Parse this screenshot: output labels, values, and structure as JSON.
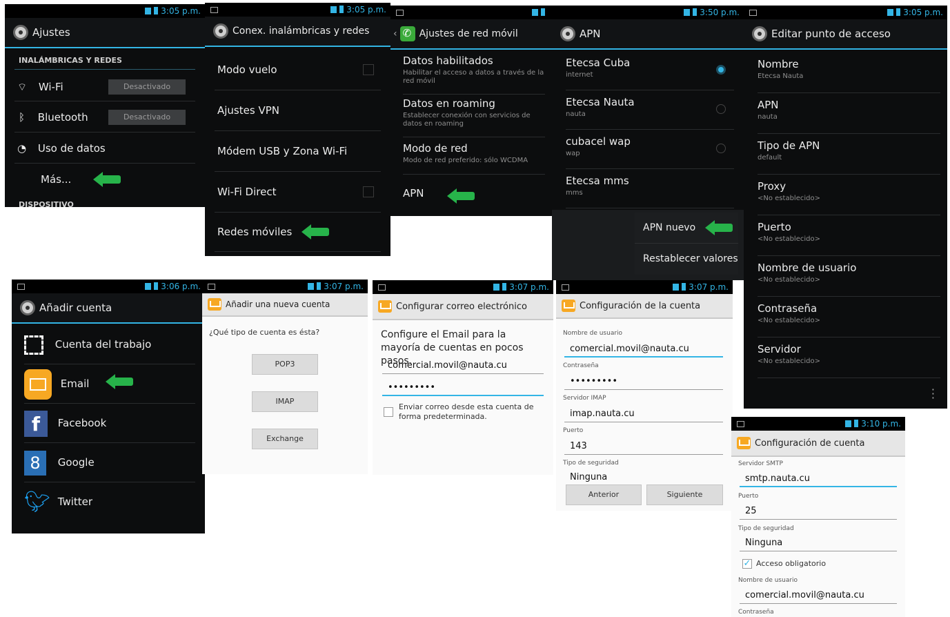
{
  "screens": {
    "ajustes": {
      "time": "3:05 p.m.",
      "title": "Ajustes",
      "section": "INALÁMBRICAS Y REDES",
      "wifi": {
        "label": "Wi-Fi",
        "state": "Desactivado"
      },
      "bluetooth": {
        "label": "Bluetooth",
        "state": "Desactivado"
      },
      "data_usage": "Uso de datos",
      "more": "Más...",
      "section2": "DISPOSITIVO"
    },
    "conex": {
      "time": "3:05 p.m.",
      "title": "Conex. inalámbricas y redes",
      "items": [
        "Modo vuelo",
        "Ajustes VPN",
        "Módem USB y Zona Wi-Fi",
        "Wi-Fi Direct",
        "Redes móviles"
      ]
    },
    "red_movil": {
      "title": "Ajustes de red móvil",
      "items": [
        {
          "label": "Datos habilitados",
          "sub": "Habilitar el acceso a datos a través de la red móvil"
        },
        {
          "label": "Datos en roaming",
          "sub": "Establecer conexión con servicios de datos en roaming"
        },
        {
          "label": "Modo de red",
          "sub": "Modo de red preferido: sólo WCDMA"
        },
        {
          "label": "APN",
          "sub": ""
        }
      ]
    },
    "apn": {
      "time": "3:50 p.m.",
      "title": "APN",
      "items": [
        {
          "label": "Etecsa Cuba",
          "sub": "internet"
        },
        {
          "label": "Etecsa Nauta",
          "sub": "nauta"
        },
        {
          "label": "cubacel wap",
          "sub": "wap"
        },
        {
          "label": "Etecsa mms",
          "sub": "mms"
        }
      ],
      "menu": [
        "APN nuevo",
        "Restablecer valores"
      ]
    },
    "editar": {
      "time": "3:05 p.m.",
      "title": "Editar punto de acceso",
      "items": [
        {
          "label": "Nombre",
          "sub": "Etecsa Nauta"
        },
        {
          "label": "APN",
          "sub": "nauta"
        },
        {
          "label": "Tipo de APN",
          "sub": "default"
        },
        {
          "label": "Proxy",
          "sub": "<No establecido>"
        },
        {
          "label": "Puerto",
          "sub": "<No establecido>"
        },
        {
          "label": "Nombre de usuario",
          "sub": "<No establecido>"
        },
        {
          "label": "Contraseña",
          "sub": "<No establecido>"
        },
        {
          "label": "Servidor",
          "sub": "<No establecido>"
        }
      ]
    },
    "anadir": {
      "time": "3:06 p.m.",
      "title": "Añadir cuenta",
      "items": [
        "Cuenta del trabajo",
        "Email",
        "Facebook",
        "Google",
        "Twitter"
      ]
    },
    "nueva_cuenta": {
      "time": "3:07 p.m.",
      "title": "Añadir una nueva cuenta",
      "question": "¿Qué tipo de cuenta es ésta?",
      "buttons": [
        "POP3",
        "IMAP",
        "Exchange"
      ]
    },
    "configurar": {
      "time": "3:07 p.m.",
      "title": "Configurar correo electrónico",
      "intro": "Configure el Email para la mayoría de cuentas en pocos pasos.",
      "email": "comercial.movil@nauta.cu",
      "password": "•••••••••",
      "default_check": "Enviar correo desde esta cuenta de forma predeterminada."
    },
    "config_cuenta": {
      "time": "3:07 p.m.",
      "title": "Configuración de la cuenta",
      "user_label": "Nombre de usuario",
      "user": "comercial.movil@nauta.cu",
      "pass_label": "Contraseña",
      "pass": "•••••••••",
      "imap_label": "Servidor IMAP",
      "imap": "imap.nauta.cu",
      "port_label": "Puerto",
      "port": "143",
      "sec_label": "Tipo de seguridad",
      "sec": "Ninguna",
      "prev": "Anterior",
      "next": "Siguiente"
    },
    "config_smtp": {
      "time": "3:10 p.m.",
      "title": "Configuración de cuenta",
      "smtp_label": "Servidor SMTP",
      "smtp": "smtp.nauta.cu",
      "port_label": "Puerto",
      "port": "25",
      "sec_label": "Tipo de seguridad",
      "sec": "Ninguna",
      "auth": "Acceso obligatorio",
      "user_label": "Nombre de usuario",
      "user": "comercial.movil@nauta.cu",
      "pass_label": "Contraseña"
    }
  },
  "colors": {
    "accent": "#33b5e5",
    "arrow": "#27b34a",
    "dark_bg": "#0c0d0e"
  }
}
